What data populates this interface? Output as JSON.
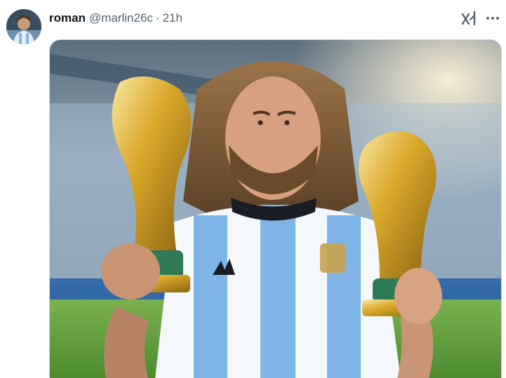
{
  "post": {
    "author": {
      "display_name": "roman",
      "handle": "@marlin26c"
    },
    "separator": "·",
    "time": "21h",
    "media": {
      "watermark": "Grok"
    },
    "icons": {
      "avatar": "profile-photo",
      "grok": "grok-logo-icon",
      "more": "more-options-icon"
    }
  },
  "colors": {
    "text_primary": "#0f1419",
    "text_secondary": "#536471",
    "border": "#cfd9de",
    "jersey_blue": "#7fb4e6",
    "trophy_gold": "#d8a92a",
    "pitch_green": "#5f9e3c"
  }
}
